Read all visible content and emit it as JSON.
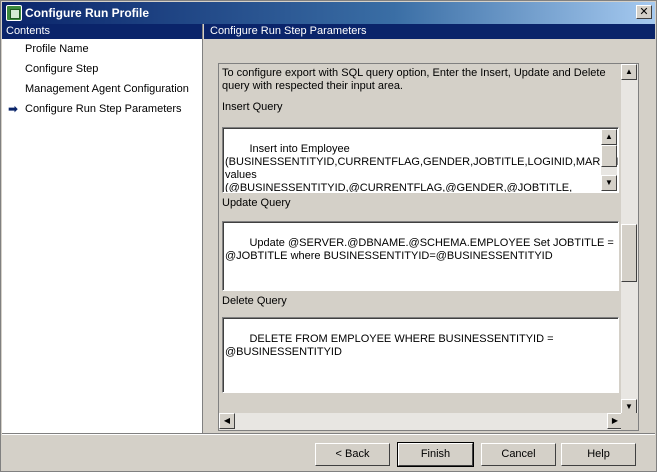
{
  "window": {
    "title": "Configure Run Profile",
    "close_glyph": "✕"
  },
  "left": {
    "header": "Contents",
    "items": [
      {
        "label": "Profile Name",
        "active": false
      },
      {
        "label": "Configure Step",
        "active": false
      },
      {
        "label": "Management Agent Configuration",
        "active": false
      },
      {
        "label": "Configure Run Step Parameters",
        "active": true
      }
    ],
    "active_icon": "arrow-right-icon"
  },
  "right": {
    "header": "Configure Run Step Parameters",
    "description": "To configure export with SQL query option, Enter the Insert, Update and Delete query with respected their input area.",
    "insert_label": "Insert Query",
    "insert_value": "Insert into Employee\n(BUSINESSENTITYID,CURRENTFLAG,GENDER,JOBTITLE,LOGINID,MARITALSTATUS,NATIONALIDNUMBER,ORGANIZATIONLEVEL,ORGANIZATIONNODE,ROWGUID,SALARIEDFLAG,SICKLEAVEHOURS,VACATIONHOURS)\nvalues (@BUSINESSENTITYID,@CURRENTFLAG,@GENDER,@JOBTITLE,",
    "update_label": "Update Query",
    "update_value": "Update @SERVER.@DBNAME.@SCHEMA.EMPLOYEE Set JOBTITLE =\n@JOBTITLE where BUSINESSENTITYID=@BUSINESSENTITYID",
    "delete_label": "Delete Query",
    "delete_value": "DELETE FROM EMPLOYEE WHERE BUSINESSENTITYID =\n@BUSINESSENTITYID"
  },
  "buttons": {
    "back": "< Back",
    "finish": "Finish",
    "cancel": "Cancel",
    "help": "Help"
  }
}
